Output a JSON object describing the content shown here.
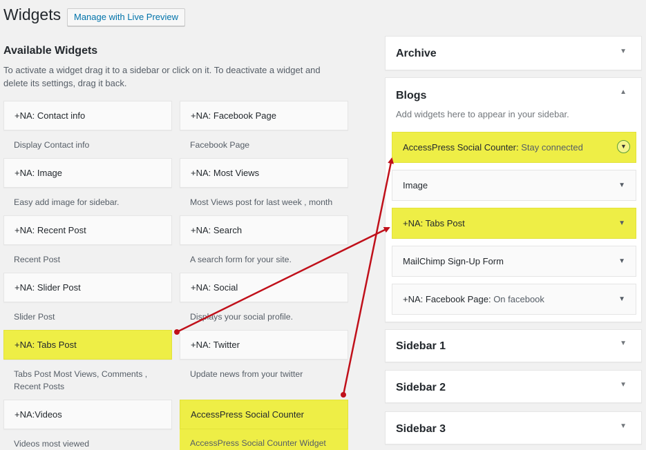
{
  "page": {
    "title": "Widgets",
    "live_preview_button": "Manage with Live Preview"
  },
  "available": {
    "heading": "Available Widgets",
    "description": "To activate a widget drag it to a sidebar or click on it. To deactivate a widget and delete its settings, drag it back.",
    "widgets": [
      {
        "title": "+NA: Contact info",
        "desc": "Display Contact info"
      },
      {
        "title": "+NA: Facebook Page",
        "desc": "Facebook Page"
      },
      {
        "title": "+NA: Image",
        "desc": "Easy add image for sidebar."
      },
      {
        "title": "+NA: Most Views",
        "desc": "Most Views post for last week , month"
      },
      {
        "title": "+NA: Recent Post",
        "desc": "Recent Post"
      },
      {
        "title": "+NA: Search",
        "desc": "A search form for your site."
      },
      {
        "title": "+NA: Slider Post",
        "desc": "Slider Post"
      },
      {
        "title": "+NA: Social",
        "desc": "Displays your social profile."
      },
      {
        "title": "+NA: Tabs Post",
        "desc": "Tabs Post Most Views, Comments , Recent Posts"
      },
      {
        "title": "+NA: Twitter",
        "desc": "Update news from your twitter"
      },
      {
        "title": "+NA:Videos",
        "desc": "Videos most viewed"
      },
      {
        "title": "AccessPress Social Counter",
        "desc": "AccessPress Social Counter Widget"
      }
    ]
  },
  "sidebars": {
    "archive": {
      "title": "Archive"
    },
    "blogs": {
      "title": "Blogs",
      "description": "Add widgets here to appear in your sidebar.",
      "widgets": [
        {
          "title": "AccessPress Social Counter:",
          "subtitle": "Stay connected"
        },
        {
          "title": "Image",
          "subtitle": ""
        },
        {
          "title": "+NA: Tabs Post",
          "subtitle": ""
        },
        {
          "title": "MailChimp Sign-Up Form",
          "subtitle": ""
        },
        {
          "title": "+NA: Facebook Page:",
          "subtitle": "On facebook"
        }
      ]
    },
    "sidebar1": {
      "title": "Sidebar 1"
    },
    "sidebar2": {
      "title": "Sidebar 2"
    },
    "sidebar3": {
      "title": "Sidebar 3"
    }
  },
  "colors": {
    "highlight": "#eeee46",
    "annotation_arrow": "#c0101a",
    "link": "#0073aa"
  }
}
